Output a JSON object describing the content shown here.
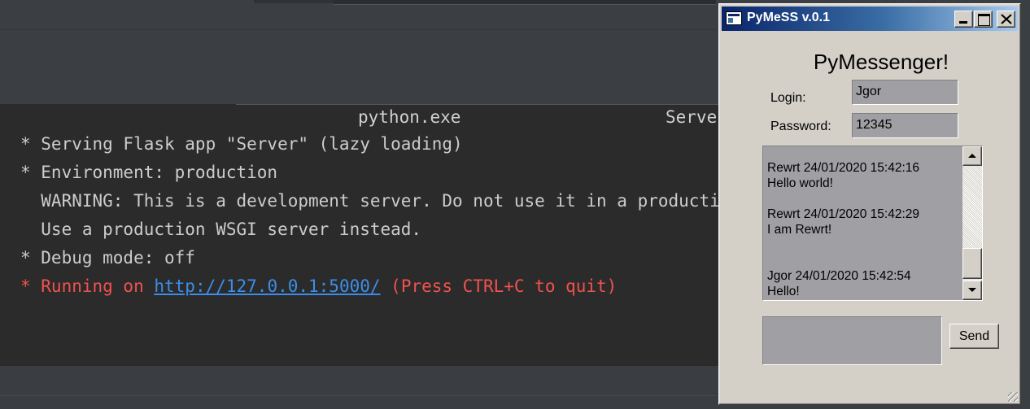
{
  "terminal": {
    "title_left": "python.exe",
    "title_right": "Server",
    "lines": [
      "* Serving Flask app \"Server\" (lazy loading)",
      "* Environment: production",
      "  WARNING: This is a development server. Do not use it in a production deployment.",
      "  Use a production WSGI server instead.",
      "* Debug mode: off"
    ],
    "running_prefix": "* Running on ",
    "running_url": "http://127.0.0.1:5000/",
    "running_suffix": " (Press CTRL+C to quit)",
    "colors": {
      "background": "#2b2b2b",
      "text": "#cccccc",
      "error": "#f0524f",
      "link": "#3b8eea"
    }
  },
  "window": {
    "title": "PyMeSS v.0.1",
    "heading": "PyMessenger!",
    "login_label": "Login:",
    "login_value": "Jgor",
    "password_label": "Password:",
    "password_value": "12345",
    "messages": [
      {
        "header": "Rewrt 24/01/2020 15:42:16",
        "body": "Hello world!"
      },
      {
        "header": "Rewrt 24/01/2020 15:42:29",
        "body": "I am Rewrt!"
      },
      {
        "header": "Jgor 24/01/2020 15:42:54",
        "body": "Hello!"
      }
    ],
    "message_input_value": "",
    "send_label": "Send",
    "colors": {
      "titlebar_start": "#0a246a",
      "titlebar_end": "#a6caf0",
      "face": "#d4d0c8",
      "field": "#a0a0a4"
    }
  }
}
